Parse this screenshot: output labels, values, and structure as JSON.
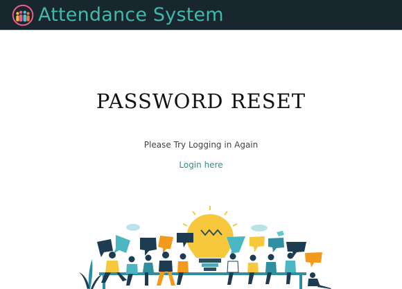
{
  "header": {
    "app_title": "Attendance System",
    "brand_color": "#42b8ad",
    "bar_color": "#18262d",
    "logo_icon": "people-group-logo-icon"
  },
  "main": {
    "title": "PASSWORD RESET",
    "message": "Please Try Logging in Again",
    "login_link_label": "Login here",
    "link_color": "#2f8f86"
  },
  "illustration": {
    "name": "team-ideas-lightbulb-illustration",
    "accent_colors": [
      "#f2c42b",
      "#2e8fa0",
      "#1d3c52",
      "#f39a1d",
      "#64c6cf"
    ]
  }
}
